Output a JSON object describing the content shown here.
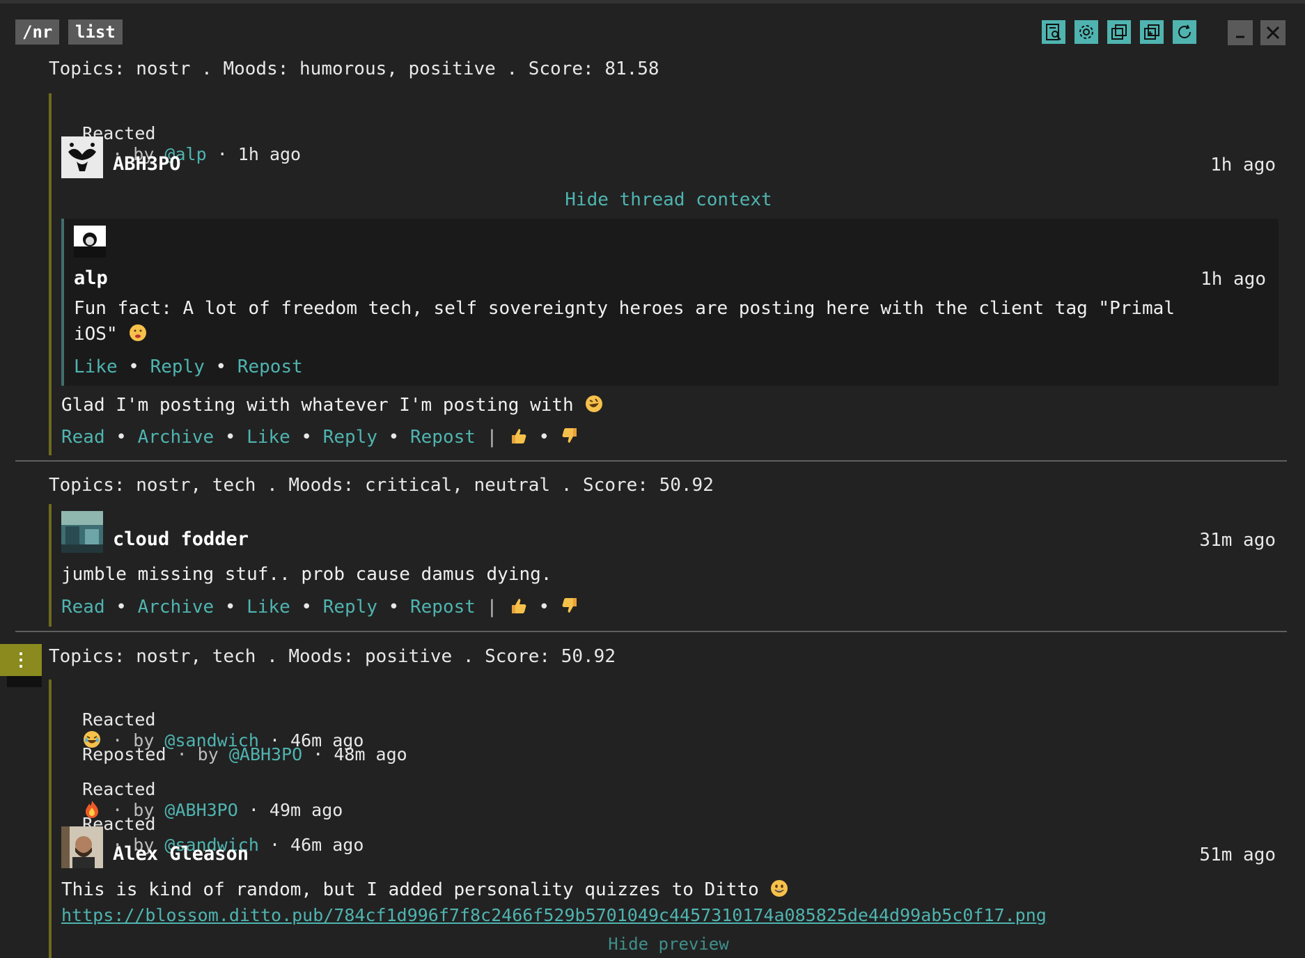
{
  "breadcrumb": [
    "/nr",
    "list"
  ],
  "toolbar": {
    "icons": [
      "search-document-icon",
      "settings-gear-icon",
      "window-stack-icon",
      "add-window-icon",
      "refresh-icon"
    ],
    "minimize": "minimize-icon",
    "close": "close-icon",
    "accent_color": "#4fb4b0"
  },
  "items": [
    {
      "topics_line": "Topics: nostr . Moods: humorous, positive . Score: 81.58",
      "reactions": [
        {
          "kind": "Reacted",
          "emoji": "thumbs-up",
          "by_prefix": " · by ",
          "user": "@alp",
          "time": " · 1h ago"
        }
      ],
      "author": "ABH3PO",
      "time": "1h ago",
      "thread_toggle": "Hide thread context",
      "thread": {
        "author": "alp",
        "time": "1h ago",
        "content_line1": "Fun fact: A lot of freedom tech, self sovereignty heroes are posting here with the client tag \"Primal",
        "content_line2": "iOS\"",
        "actions": [
          "Like",
          "Reply",
          "Repost"
        ]
      },
      "content": "Glad I'm posting with whatever I'm posting with",
      "actions": [
        "Read",
        "Archive",
        "Like",
        "Reply",
        "Repost"
      ]
    },
    {
      "topics_line": "Topics: nostr, tech . Moods: critical, neutral . Score: 50.92",
      "author": "cloud fodder",
      "time": "31m ago",
      "content": "jumble missing stuf.. prob cause damus dying.",
      "actions": [
        "Read",
        "Archive",
        "Like",
        "Reply",
        "Repost"
      ]
    },
    {
      "topics_line": "Topics: nostr, tech . Moods: positive . Score: 50.92",
      "reactions": [
        {
          "kind": "Reacted",
          "emoji": "laughing",
          "by_prefix": " · by ",
          "user": "@sandwich",
          "time": " · 46m ago"
        },
        {
          "kind": "Reposted",
          "emoji": "",
          "by_prefix": " · by ",
          "user": "@ABH3PO",
          "time": " · 48m ago"
        },
        {
          "kind": "Reacted",
          "emoji": "fire",
          "by_prefix": " · by ",
          "user": "@ABH3PO",
          "time": " · 49m ago"
        },
        {
          "kind": "Reacted",
          "emoji": "fire",
          "by_prefix": " · by ",
          "user": "@sandwich",
          "time": " · 46m ago"
        }
      ],
      "author": "Alex Gleason",
      "time": "51m ago",
      "content": "This is kind of random, but I added personality quizzes to Ditto",
      "url": "https://blossom.ditto.pub/784cf1d996f7f8c2466f529b5701049c4457310174a085825de44d99ab5c0f17.png",
      "preview_toggle": "Hide preview"
    }
  ],
  "menu_handle": "⋮"
}
